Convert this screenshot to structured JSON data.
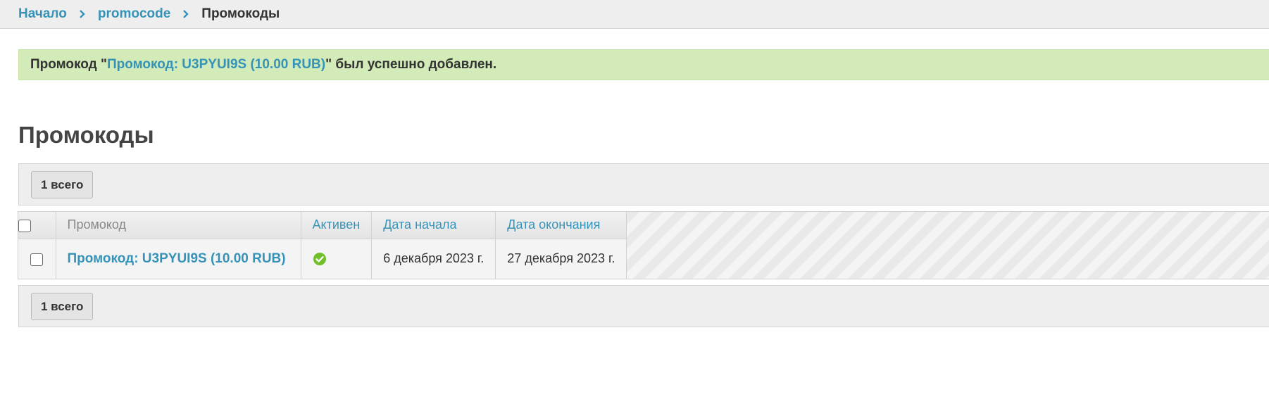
{
  "breadcrumbs": {
    "home": "Начало",
    "app": "promocode",
    "current": "Промокоды"
  },
  "message": {
    "prefix": "Промокод \"",
    "link": "Промокод: U3PYUI9S (10.00 RUB)",
    "suffix": "\" был успешно добавлен."
  },
  "page_title": "Промокоды",
  "paginator": {
    "count_label": "1 всего"
  },
  "table": {
    "columns": {
      "promocode": "Промокод",
      "active": "Активен",
      "start_date": "Дата начала",
      "end_date": "Дата окончания"
    },
    "rows": [
      {
        "promocode": "Промокод: U3PYUI9S (10.00 RUB)",
        "active_icon": "check-circle-icon",
        "start_date": "6 декабря 2023 г.",
        "end_date": "27 декабря 2023 г."
      }
    ]
  },
  "colors": {
    "link": "#3693b8",
    "success_bg": "#d2ebb8",
    "active_yes": "#70bf2b"
  }
}
